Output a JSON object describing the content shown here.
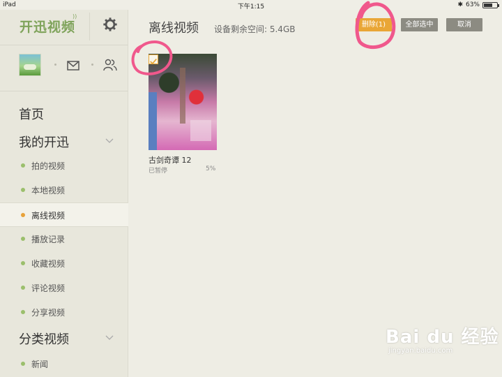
{
  "status_bar": {
    "device": "iPad",
    "time": "下午1:15",
    "battery": "63%",
    "battery_level": 0.63
  },
  "sidebar": {
    "brand": "开迅视频",
    "main_menu": [
      "首页",
      "我的开迅"
    ],
    "sub_items": [
      "拍的视频",
      "本地视频",
      "离线视频",
      "播放记录",
      "收藏视频",
      "评论视频",
      "分享视频"
    ],
    "active_index": 2,
    "category_title": "分类视频",
    "partial_item": "新闻"
  },
  "header": {
    "title": "离线视频",
    "storage": "设备剩余空间: 5.4GB",
    "delete_label": "删除(1)",
    "select_all_label": "全部选中",
    "cancel_label": "取消"
  },
  "video": {
    "title": "古剑奇谭 12",
    "status": "已暂停",
    "progress": "5%",
    "selected": true
  },
  "watermark": {
    "main": "Bai du 经验",
    "sub": "jingyan.baidu.com"
  },
  "colors": {
    "accent": "#e9a636",
    "brand": "#7fa35b",
    "annotation": "#f0588c"
  }
}
